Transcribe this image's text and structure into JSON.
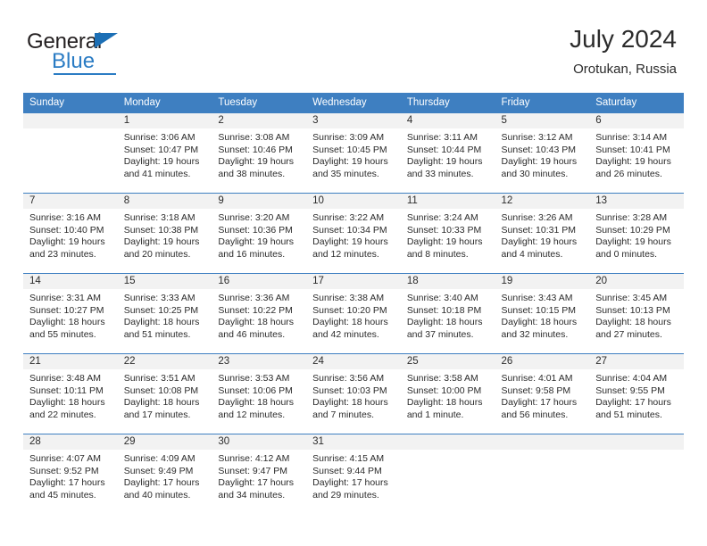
{
  "brand": {
    "name_part1": "General",
    "name_part2": "Blue",
    "triangle_color": "#1c6fb5",
    "blue_color": "#2b7cc4"
  },
  "header": {
    "title": "July 2024",
    "subtitle": "Orotukan, Russia"
  },
  "theme": {
    "header_bg": "#3e7fc1",
    "daynum_bg": "#f2f2f2",
    "row_divider": "#3e7fc1",
    "text": "#2b2b2b"
  },
  "labels": {
    "sunrise_prefix": "Sunrise:",
    "sunset_prefix": "Sunset:",
    "daylight_prefix": "Daylight:"
  },
  "weekdays": [
    "Sunday",
    "Monday",
    "Tuesday",
    "Wednesday",
    "Thursday",
    "Friday",
    "Saturday"
  ],
  "weeks": [
    [
      {
        "day": "",
        "empty": true
      },
      {
        "day": "1",
        "sunrise": "Sunrise: 3:06 AM",
        "sunset": "Sunset: 10:47 PM",
        "daylight_line1": "Daylight: 19 hours",
        "daylight_line2": "and 41 minutes."
      },
      {
        "day": "2",
        "sunrise": "Sunrise: 3:08 AM",
        "sunset": "Sunset: 10:46 PM",
        "daylight_line1": "Daylight: 19 hours",
        "daylight_line2": "and 38 minutes."
      },
      {
        "day": "3",
        "sunrise": "Sunrise: 3:09 AM",
        "sunset": "Sunset: 10:45 PM",
        "daylight_line1": "Daylight: 19 hours",
        "daylight_line2": "and 35 minutes."
      },
      {
        "day": "4",
        "sunrise": "Sunrise: 3:11 AM",
        "sunset": "Sunset: 10:44 PM",
        "daylight_line1": "Daylight: 19 hours",
        "daylight_line2": "and 33 minutes."
      },
      {
        "day": "5",
        "sunrise": "Sunrise: 3:12 AM",
        "sunset": "Sunset: 10:43 PM",
        "daylight_line1": "Daylight: 19 hours",
        "daylight_line2": "and 30 minutes."
      },
      {
        "day": "6",
        "sunrise": "Sunrise: 3:14 AM",
        "sunset": "Sunset: 10:41 PM",
        "daylight_line1": "Daylight: 19 hours",
        "daylight_line2": "and 26 minutes."
      }
    ],
    [
      {
        "day": "7",
        "sunrise": "Sunrise: 3:16 AM",
        "sunset": "Sunset: 10:40 PM",
        "daylight_line1": "Daylight: 19 hours",
        "daylight_line2": "and 23 minutes."
      },
      {
        "day": "8",
        "sunrise": "Sunrise: 3:18 AM",
        "sunset": "Sunset: 10:38 PM",
        "daylight_line1": "Daylight: 19 hours",
        "daylight_line2": "and 20 minutes."
      },
      {
        "day": "9",
        "sunrise": "Sunrise: 3:20 AM",
        "sunset": "Sunset: 10:36 PM",
        "daylight_line1": "Daylight: 19 hours",
        "daylight_line2": "and 16 minutes."
      },
      {
        "day": "10",
        "sunrise": "Sunrise: 3:22 AM",
        "sunset": "Sunset: 10:34 PM",
        "daylight_line1": "Daylight: 19 hours",
        "daylight_line2": "and 12 minutes."
      },
      {
        "day": "11",
        "sunrise": "Sunrise: 3:24 AM",
        "sunset": "Sunset: 10:33 PM",
        "daylight_line1": "Daylight: 19 hours",
        "daylight_line2": "and 8 minutes."
      },
      {
        "day": "12",
        "sunrise": "Sunrise: 3:26 AM",
        "sunset": "Sunset: 10:31 PM",
        "daylight_line1": "Daylight: 19 hours",
        "daylight_line2": "and 4 minutes."
      },
      {
        "day": "13",
        "sunrise": "Sunrise: 3:28 AM",
        "sunset": "Sunset: 10:29 PM",
        "daylight_line1": "Daylight: 19 hours",
        "daylight_line2": "and 0 minutes."
      }
    ],
    [
      {
        "day": "14",
        "sunrise": "Sunrise: 3:31 AM",
        "sunset": "Sunset: 10:27 PM",
        "daylight_line1": "Daylight: 18 hours",
        "daylight_line2": "and 55 minutes."
      },
      {
        "day": "15",
        "sunrise": "Sunrise: 3:33 AM",
        "sunset": "Sunset: 10:25 PM",
        "daylight_line1": "Daylight: 18 hours",
        "daylight_line2": "and 51 minutes."
      },
      {
        "day": "16",
        "sunrise": "Sunrise: 3:36 AM",
        "sunset": "Sunset: 10:22 PM",
        "daylight_line1": "Daylight: 18 hours",
        "daylight_line2": "and 46 minutes."
      },
      {
        "day": "17",
        "sunrise": "Sunrise: 3:38 AM",
        "sunset": "Sunset: 10:20 PM",
        "daylight_line1": "Daylight: 18 hours",
        "daylight_line2": "and 42 minutes."
      },
      {
        "day": "18",
        "sunrise": "Sunrise: 3:40 AM",
        "sunset": "Sunset: 10:18 PM",
        "daylight_line1": "Daylight: 18 hours",
        "daylight_line2": "and 37 minutes."
      },
      {
        "day": "19",
        "sunrise": "Sunrise: 3:43 AM",
        "sunset": "Sunset: 10:15 PM",
        "daylight_line1": "Daylight: 18 hours",
        "daylight_line2": "and 32 minutes."
      },
      {
        "day": "20",
        "sunrise": "Sunrise: 3:45 AM",
        "sunset": "Sunset: 10:13 PM",
        "daylight_line1": "Daylight: 18 hours",
        "daylight_line2": "and 27 minutes."
      }
    ],
    [
      {
        "day": "21",
        "sunrise": "Sunrise: 3:48 AM",
        "sunset": "Sunset: 10:11 PM",
        "daylight_line1": "Daylight: 18 hours",
        "daylight_line2": "and 22 minutes."
      },
      {
        "day": "22",
        "sunrise": "Sunrise: 3:51 AM",
        "sunset": "Sunset: 10:08 PM",
        "daylight_line1": "Daylight: 18 hours",
        "daylight_line2": "and 17 minutes."
      },
      {
        "day": "23",
        "sunrise": "Sunrise: 3:53 AM",
        "sunset": "Sunset: 10:06 PM",
        "daylight_line1": "Daylight: 18 hours",
        "daylight_line2": "and 12 minutes."
      },
      {
        "day": "24",
        "sunrise": "Sunrise: 3:56 AM",
        "sunset": "Sunset: 10:03 PM",
        "daylight_line1": "Daylight: 18 hours",
        "daylight_line2": "and 7 minutes."
      },
      {
        "day": "25",
        "sunrise": "Sunrise: 3:58 AM",
        "sunset": "Sunset: 10:00 PM",
        "daylight_line1": "Daylight: 18 hours",
        "daylight_line2": "and 1 minute."
      },
      {
        "day": "26",
        "sunrise": "Sunrise: 4:01 AM",
        "sunset": "Sunset: 9:58 PM",
        "daylight_line1": "Daylight: 17 hours",
        "daylight_line2": "and 56 minutes."
      },
      {
        "day": "27",
        "sunrise": "Sunrise: 4:04 AM",
        "sunset": "Sunset: 9:55 PM",
        "daylight_line1": "Daylight: 17 hours",
        "daylight_line2": "and 51 minutes."
      }
    ],
    [
      {
        "day": "28",
        "sunrise": "Sunrise: 4:07 AM",
        "sunset": "Sunset: 9:52 PM",
        "daylight_line1": "Daylight: 17 hours",
        "daylight_line2": "and 45 minutes."
      },
      {
        "day": "29",
        "sunrise": "Sunrise: 4:09 AM",
        "sunset": "Sunset: 9:49 PM",
        "daylight_line1": "Daylight: 17 hours",
        "daylight_line2": "and 40 minutes."
      },
      {
        "day": "30",
        "sunrise": "Sunrise: 4:12 AM",
        "sunset": "Sunset: 9:47 PM",
        "daylight_line1": "Daylight: 17 hours",
        "daylight_line2": "and 34 minutes."
      },
      {
        "day": "31",
        "sunrise": "Sunrise: 4:15 AM",
        "sunset": "Sunset: 9:44 PM",
        "daylight_line1": "Daylight: 17 hours",
        "daylight_line2": "and 29 minutes."
      },
      {
        "day": "",
        "empty": true
      },
      {
        "day": "",
        "empty": true
      },
      {
        "day": "",
        "empty": true
      }
    ]
  ]
}
